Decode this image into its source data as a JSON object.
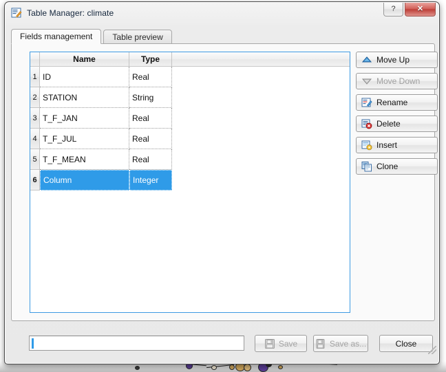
{
  "window": {
    "title": "Table Manager: climate",
    "icon": "table-editor-icon",
    "help_label": "?",
    "close_label": "✕"
  },
  "tabs": [
    {
      "label": "Fields management",
      "active": true
    },
    {
      "label": "Table preview",
      "active": false
    }
  ],
  "grid": {
    "columns": [
      "",
      "Name",
      "Type"
    ],
    "rows": [
      {
        "num": "1",
        "name": "ID",
        "type": "Real",
        "selected": false
      },
      {
        "num": "2",
        "name": "STATION",
        "type": "String",
        "selected": false
      },
      {
        "num": "3",
        "name": "T_F_JAN",
        "type": "Real",
        "selected": false
      },
      {
        "num": "4",
        "name": "T_F_JUL",
        "type": "Real",
        "selected": false
      },
      {
        "num": "5",
        "name": "T_F_MEAN",
        "type": "Real",
        "selected": false
      },
      {
        "num": "6",
        "name": "Column",
        "type": "Integer",
        "selected": true
      }
    ],
    "selection_color": "#2f9be8",
    "focus_border_color": "#3d9ae2"
  },
  "side_buttons": [
    {
      "label": "Move Up",
      "icon": "arrow-up-icon",
      "disabled": false
    },
    {
      "label": "Move Down",
      "icon": "arrow-down-icon",
      "disabled": true
    },
    {
      "label": "Rename",
      "icon": "rename-pencil-icon",
      "disabled": false
    },
    {
      "label": "Delete",
      "icon": "delete-icon",
      "disabled": false
    },
    {
      "label": "Insert",
      "icon": "insert-icon",
      "disabled": false
    },
    {
      "label": "Clone",
      "icon": "clone-icon",
      "disabled": false
    }
  ],
  "bottom": {
    "input_value": "",
    "input_placeholder": "",
    "save_label": "Save",
    "save_disabled": true,
    "save_as_label": "Save as...",
    "save_as_disabled": true,
    "close_label": "Close",
    "close_disabled": false
  }
}
